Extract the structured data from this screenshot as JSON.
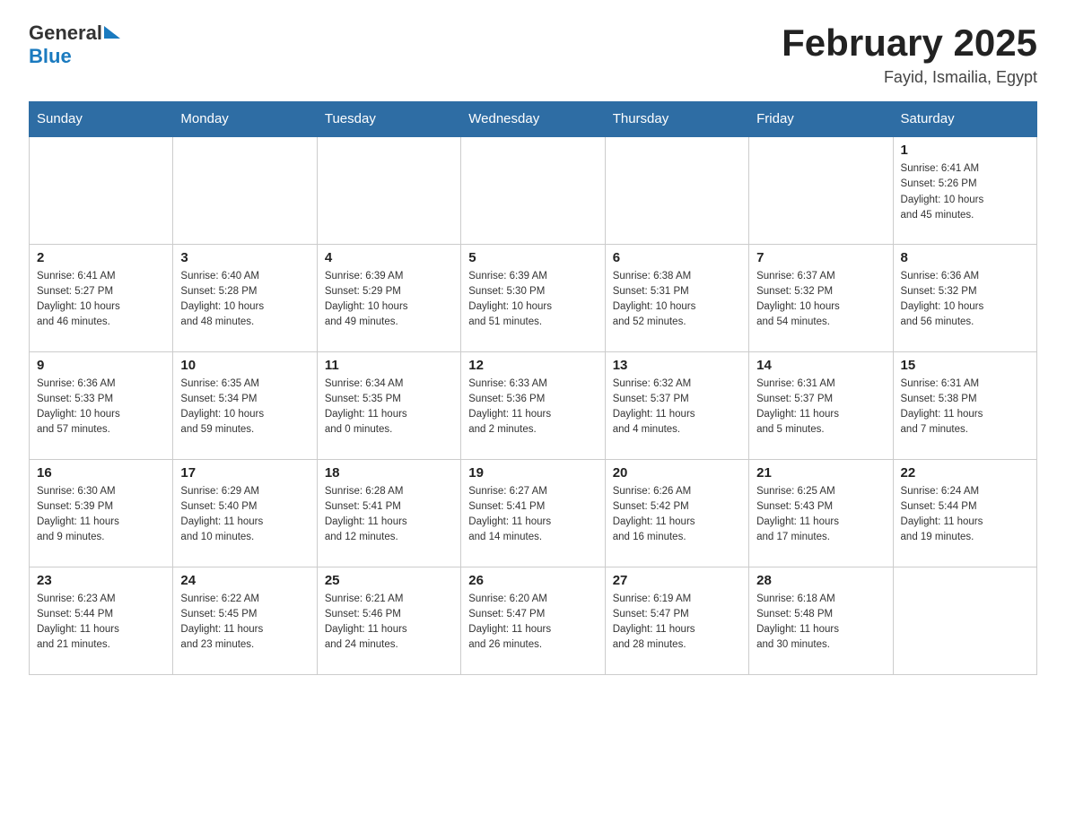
{
  "header": {
    "logo_general": "General",
    "logo_blue": "Blue",
    "title": "February 2025",
    "subtitle": "Fayid, Ismailia, Egypt"
  },
  "weekdays": [
    "Sunday",
    "Monday",
    "Tuesday",
    "Wednesday",
    "Thursday",
    "Friday",
    "Saturday"
  ],
  "weeks": [
    [
      {
        "day": "",
        "info": ""
      },
      {
        "day": "",
        "info": ""
      },
      {
        "day": "",
        "info": ""
      },
      {
        "day": "",
        "info": ""
      },
      {
        "day": "",
        "info": ""
      },
      {
        "day": "",
        "info": ""
      },
      {
        "day": "1",
        "info": "Sunrise: 6:41 AM\nSunset: 5:26 PM\nDaylight: 10 hours\nand 45 minutes."
      }
    ],
    [
      {
        "day": "2",
        "info": "Sunrise: 6:41 AM\nSunset: 5:27 PM\nDaylight: 10 hours\nand 46 minutes."
      },
      {
        "day": "3",
        "info": "Sunrise: 6:40 AM\nSunset: 5:28 PM\nDaylight: 10 hours\nand 48 minutes."
      },
      {
        "day": "4",
        "info": "Sunrise: 6:39 AM\nSunset: 5:29 PM\nDaylight: 10 hours\nand 49 minutes."
      },
      {
        "day": "5",
        "info": "Sunrise: 6:39 AM\nSunset: 5:30 PM\nDaylight: 10 hours\nand 51 minutes."
      },
      {
        "day": "6",
        "info": "Sunrise: 6:38 AM\nSunset: 5:31 PM\nDaylight: 10 hours\nand 52 minutes."
      },
      {
        "day": "7",
        "info": "Sunrise: 6:37 AM\nSunset: 5:32 PM\nDaylight: 10 hours\nand 54 minutes."
      },
      {
        "day": "8",
        "info": "Sunrise: 6:36 AM\nSunset: 5:32 PM\nDaylight: 10 hours\nand 56 minutes."
      }
    ],
    [
      {
        "day": "9",
        "info": "Sunrise: 6:36 AM\nSunset: 5:33 PM\nDaylight: 10 hours\nand 57 minutes."
      },
      {
        "day": "10",
        "info": "Sunrise: 6:35 AM\nSunset: 5:34 PM\nDaylight: 10 hours\nand 59 minutes."
      },
      {
        "day": "11",
        "info": "Sunrise: 6:34 AM\nSunset: 5:35 PM\nDaylight: 11 hours\nand 0 minutes."
      },
      {
        "day": "12",
        "info": "Sunrise: 6:33 AM\nSunset: 5:36 PM\nDaylight: 11 hours\nand 2 minutes."
      },
      {
        "day": "13",
        "info": "Sunrise: 6:32 AM\nSunset: 5:37 PM\nDaylight: 11 hours\nand 4 minutes."
      },
      {
        "day": "14",
        "info": "Sunrise: 6:31 AM\nSunset: 5:37 PM\nDaylight: 11 hours\nand 5 minutes."
      },
      {
        "day": "15",
        "info": "Sunrise: 6:31 AM\nSunset: 5:38 PM\nDaylight: 11 hours\nand 7 minutes."
      }
    ],
    [
      {
        "day": "16",
        "info": "Sunrise: 6:30 AM\nSunset: 5:39 PM\nDaylight: 11 hours\nand 9 minutes."
      },
      {
        "day": "17",
        "info": "Sunrise: 6:29 AM\nSunset: 5:40 PM\nDaylight: 11 hours\nand 10 minutes."
      },
      {
        "day": "18",
        "info": "Sunrise: 6:28 AM\nSunset: 5:41 PM\nDaylight: 11 hours\nand 12 minutes."
      },
      {
        "day": "19",
        "info": "Sunrise: 6:27 AM\nSunset: 5:41 PM\nDaylight: 11 hours\nand 14 minutes."
      },
      {
        "day": "20",
        "info": "Sunrise: 6:26 AM\nSunset: 5:42 PM\nDaylight: 11 hours\nand 16 minutes."
      },
      {
        "day": "21",
        "info": "Sunrise: 6:25 AM\nSunset: 5:43 PM\nDaylight: 11 hours\nand 17 minutes."
      },
      {
        "day": "22",
        "info": "Sunrise: 6:24 AM\nSunset: 5:44 PM\nDaylight: 11 hours\nand 19 minutes."
      }
    ],
    [
      {
        "day": "23",
        "info": "Sunrise: 6:23 AM\nSunset: 5:44 PM\nDaylight: 11 hours\nand 21 minutes."
      },
      {
        "day": "24",
        "info": "Sunrise: 6:22 AM\nSunset: 5:45 PM\nDaylight: 11 hours\nand 23 minutes."
      },
      {
        "day": "25",
        "info": "Sunrise: 6:21 AM\nSunset: 5:46 PM\nDaylight: 11 hours\nand 24 minutes."
      },
      {
        "day": "26",
        "info": "Sunrise: 6:20 AM\nSunset: 5:47 PM\nDaylight: 11 hours\nand 26 minutes."
      },
      {
        "day": "27",
        "info": "Sunrise: 6:19 AM\nSunset: 5:47 PM\nDaylight: 11 hours\nand 28 minutes."
      },
      {
        "day": "28",
        "info": "Sunrise: 6:18 AM\nSunset: 5:48 PM\nDaylight: 11 hours\nand 30 minutes."
      },
      {
        "day": "",
        "info": ""
      }
    ]
  ]
}
